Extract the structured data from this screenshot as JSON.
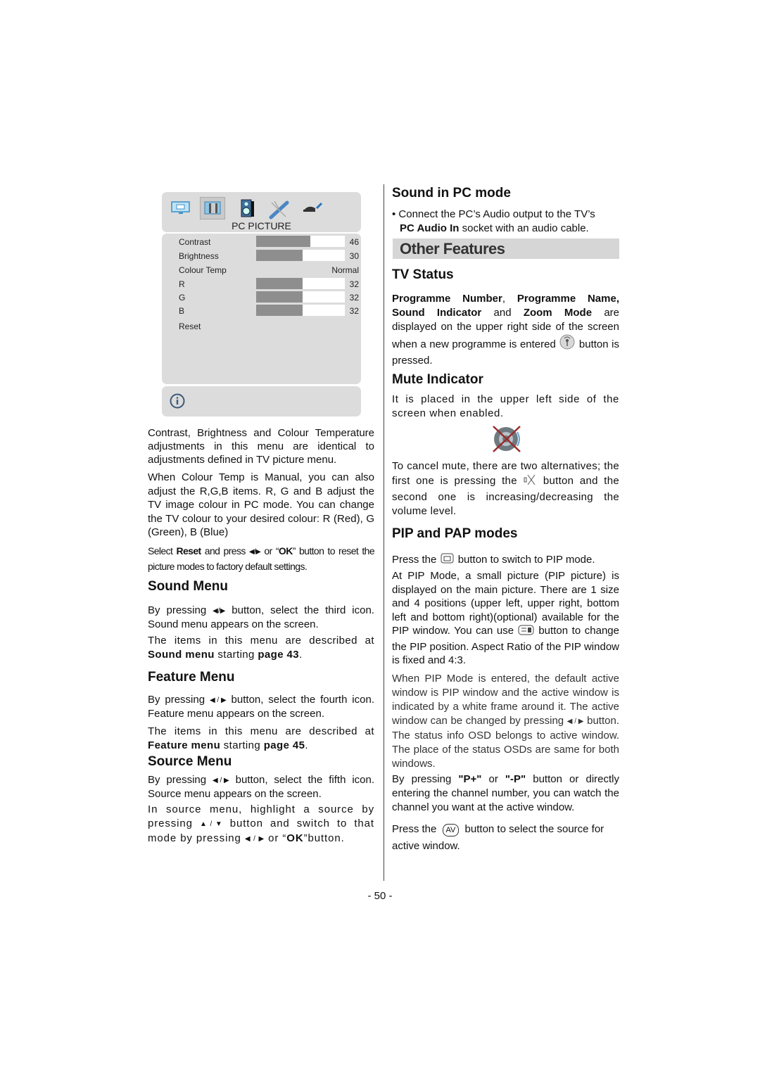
{
  "osd_menu": {
    "tabs": [
      {
        "icon": "picture-icon",
        "selected": false
      },
      {
        "icon": "pc-picture-icon",
        "selected": true
      },
      {
        "icon": "sound-icon",
        "selected": false
      },
      {
        "icon": "feature-icon",
        "selected": false
      },
      {
        "icon": "source-icon",
        "selected": false
      }
    ],
    "title": "PC PICTURE",
    "items": [
      {
        "label": "Contrast",
        "value": "46",
        "level": 0.61
      },
      {
        "label": "Brightness",
        "value": "30",
        "level": 0.52
      },
      {
        "label": "Colour Temp",
        "value": "Normal"
      },
      {
        "label": "R",
        "value": "32",
        "level": 0.52
      },
      {
        "label": "G",
        "value": "32",
        "level": 0.52
      },
      {
        "label": "B",
        "value": "32",
        "level": 0.52
      },
      {
        "label": "Reset"
      }
    ],
    "info_icon": "info-icon"
  },
  "left": {
    "para1": "Contrast, Brightness and Colour Temperature adjustments in this menu are identical to adjustments defined in TV picture menu.",
    "para2": "When Colour Temp is Manual, you can also adjust the R,G,B items. R, G and B adjust the TV image colour in PC mode. You can change the TV colour to your desired colour: R (Red), G (Green), B (Blue)",
    "para3": {
      "a": "Select ",
      "b": "Reset",
      "c": " and press ",
      "d": " or “",
      "e": "OK",
      "f": "” button to reset the picture modes to factory default settings."
    },
    "sound_menu": {
      "heading": "Sound Menu",
      "p1a": "By pressing ",
      "p1b": " button, select the third icon. Sound menu appears on the screen.",
      "p2a": "The items in this menu are described at ",
      "p2b": "Sound menu",
      "p2c": " starting ",
      "p2d": "page 43",
      "p2e": "."
    },
    "feature_menu": {
      "heading": "Feature Menu",
      "p1a": "By pressing ",
      "p1b": " button, select the fourth icon. Feature menu appears on the screen.",
      "p2a": "The items in this menu are described at ",
      "p2b": "Feature menu",
      "p2c": " starting ",
      "p2d": "page 45",
      "p2e": "."
    },
    "source_menu": {
      "heading": "Source Menu",
      "p1a": "By pressing ",
      "p1b": " button, select the fifth icon. Source menu appears on the screen.",
      "p2a": "In source menu, highlight a source by pressing ",
      "p2b": " button and switch to that mode by pressing ",
      "p2c": " or “",
      "p2d": "OK",
      "p2e": "”button."
    }
  },
  "right": {
    "sound_pc": {
      "heading": "Sound in PC mode",
      "bullet_a": "• Connect the PC’s Audio output to the TV’s ",
      "bullet_b": "PC Audio In",
      "bullet_c": " socket with an audio cable."
    },
    "other_features": "Other Features",
    "tv_status": {
      "heading": "TV Status",
      "b1": "Programme Number",
      "t1": ", ",
      "b2": "Programme Name,",
      "t2": " ",
      "b3": "Sound Indicator",
      "t3": " and ",
      "b4": "Zoom Mode",
      "t4": " are displayed on the upper right side of the screen when a new programme is entered ",
      "t5": " button is pressed."
    },
    "mute": {
      "heading": "Mute Indicator",
      "p1": "It is placed in the upper left side of the screen when enabled.",
      "p2a": "To cancel mute, there are two alternatives; the first one is pressing the ",
      "p2b": " button and the second one is increasing/decreasing the volume level."
    },
    "pip": {
      "heading": "PIP and PAP modes",
      "p1a": "Press the ",
      "p1b": " button to switch to PIP mode.",
      "p2a": "At PIP Mode, a small picture (PIP picture) is displayed on the main picture. There are 1 size and 4 positions (upper left, upper right, bottom left and bottom right)(optional) available for the PIP window. You can use ",
      "p2b": " button to change the PIP position. Aspect Ratio of the PIP window is fixed and 4:3.",
      "p3a": "When PIP Mode is entered, the default active window is PIP window and the active window is indicated by a white frame around it. The active window can be changed by pressing ",
      "p3b": " button. The status info OSD belongs to active window. The place of the status OSDs are same for both windows.",
      "p4a": "By pressing ",
      "p4b": "\"P+\"",
      "p4c": " or ",
      "p4d": "\"-P\"",
      "p4e": " button or directly entering the channel number, you can watch the channel you want at the active window.",
      "p5a": "Press the ",
      "p5b": "AV",
      "p5c": " button to select the source for active window."
    }
  },
  "page_number": "- 50 -"
}
